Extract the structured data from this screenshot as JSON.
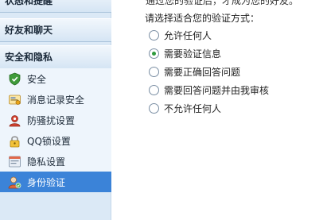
{
  "sidebar": {
    "sections": [
      {
        "label": "状态和提醒"
      },
      {
        "label": "好友和聊天"
      },
      {
        "label": "安全和隐私"
      }
    ],
    "items": [
      {
        "label": "安全",
        "icon": "shield-icon"
      },
      {
        "label": "消息记录安全",
        "icon": "message-record-icon"
      },
      {
        "label": "防骚扰设置",
        "icon": "anti-harassment-icon"
      },
      {
        "label": "QQ锁设置",
        "icon": "lock-icon"
      },
      {
        "label": "隐私设置",
        "icon": "privacy-icon"
      },
      {
        "label": "身份验证",
        "icon": "identity-verify-icon",
        "active": true
      }
    ]
  },
  "main": {
    "top_text": "通过您的验证后，才成为您的好友。",
    "prompt": "请选择适合您的验证方式：",
    "options": [
      {
        "label": "允许任何人",
        "checked": false
      },
      {
        "label": "需要验证信息",
        "checked": true
      },
      {
        "label": "需要正确回答问题",
        "checked": false
      },
      {
        "label": "需要回答问题并由我审核",
        "checked": false
      },
      {
        "label": "不允许任何人",
        "checked": false
      }
    ]
  },
  "colors": {
    "accent": "#3b83d8",
    "sidebar_bg": "#dbe9f6",
    "radio_selected": "#2e9a3c"
  }
}
